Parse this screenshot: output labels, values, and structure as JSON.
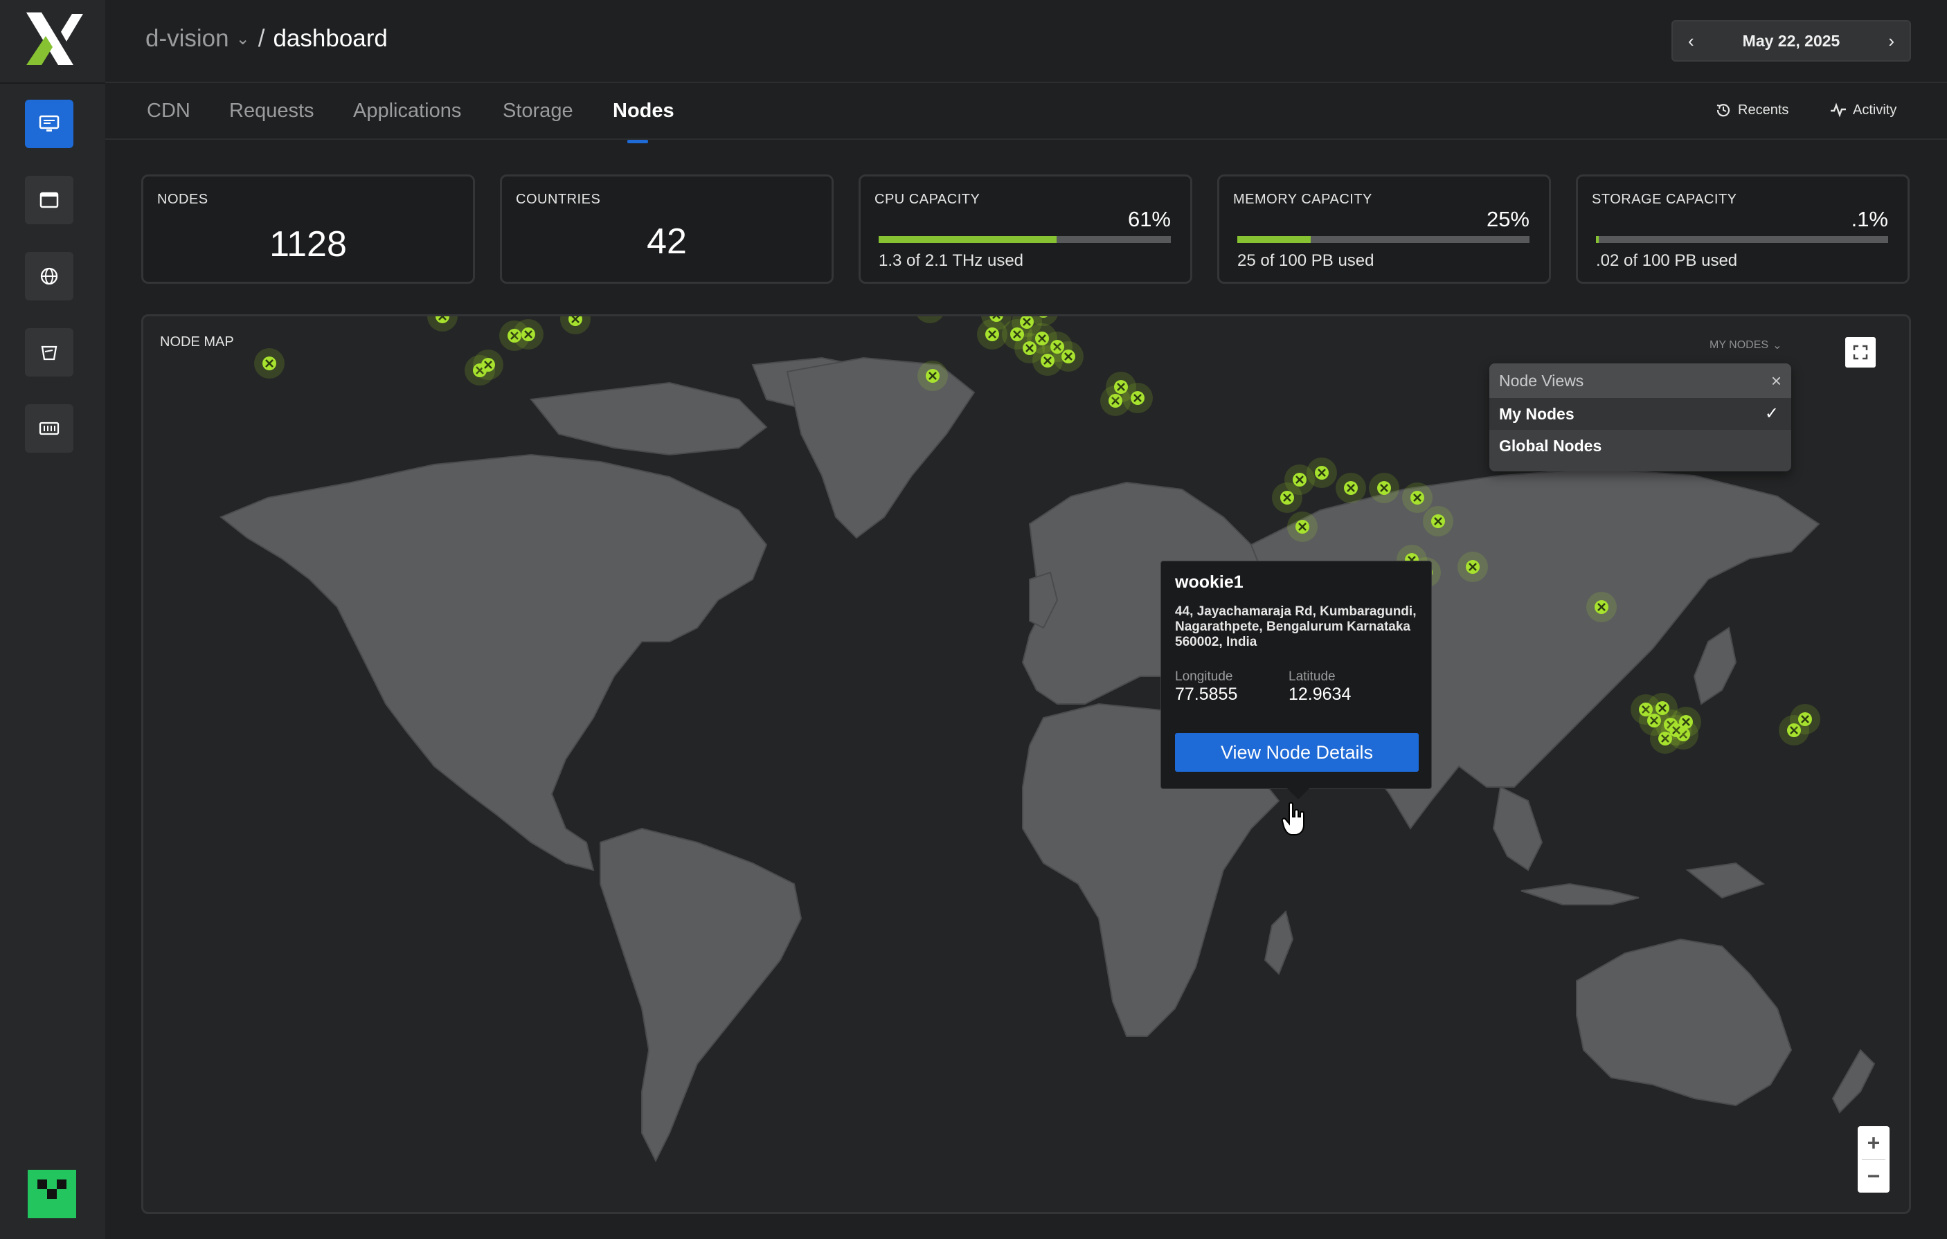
{
  "header": {
    "org": "d-vision",
    "separator": "/",
    "page": "dashboard",
    "date": "May 22, 2025"
  },
  "sidebar": {
    "items": [
      {
        "icon": "monitor-icon",
        "active": true
      },
      {
        "icon": "window-icon",
        "active": false
      },
      {
        "icon": "globe-icon",
        "active": false
      },
      {
        "icon": "bucket-icon",
        "active": false
      },
      {
        "icon": "server-icon",
        "active": false
      }
    ]
  },
  "tabs": [
    {
      "label": "CDN"
    },
    {
      "label": "Requests"
    },
    {
      "label": "Applications"
    },
    {
      "label": "Storage"
    },
    {
      "label": "Nodes",
      "active": true
    }
  ],
  "tools": {
    "recents": "Recents",
    "activity": "Activity"
  },
  "stats": {
    "nodes": {
      "label": "NODES",
      "value": "1128"
    },
    "countries": {
      "label": "COUNTRIES",
      "value": "42"
    },
    "cpu": {
      "label": "CPU CAPACITY",
      "percent_text": "61%",
      "percent": 61,
      "used": "1.3 of 2.1 THz used"
    },
    "memory": {
      "label": "MEMORY CAPACITY",
      "percent_text": "25%",
      "percent": 25,
      "used": "25 of 100 PB used"
    },
    "storage": {
      "label": "STORAGE CAPACITY",
      "percent_text": ".1%",
      "percent": 1,
      "used": ".02 of 100 PB used"
    }
  },
  "map": {
    "title": "NODE MAP",
    "view_selector": "MY NODES",
    "dropdown": {
      "title": "Node Views",
      "options": [
        {
          "label": "My Nodes",
          "selected": true
        },
        {
          "label": "Global Nodes",
          "selected": false
        }
      ]
    },
    "zoom_in": "+",
    "zoom_out": "−",
    "popup": {
      "name": "wookie1",
      "address": "44, Jayachamaraja Rd, Kumbaragundi, Nagarathpete, Bengalurum Karnataka 560002, India",
      "longitude_label": "Longitude",
      "longitude": "77.5855",
      "latitude_label": "Latitude",
      "latitude": "12.9634",
      "button": "View Node Details"
    }
  },
  "colors": {
    "accent": "#1e6ad6",
    "node": "#a6e22e",
    "bar_fill": "#86c232",
    "avatar": "#22c55e",
    "land": "#5b5c5e",
    "ocean": "#242526"
  }
}
